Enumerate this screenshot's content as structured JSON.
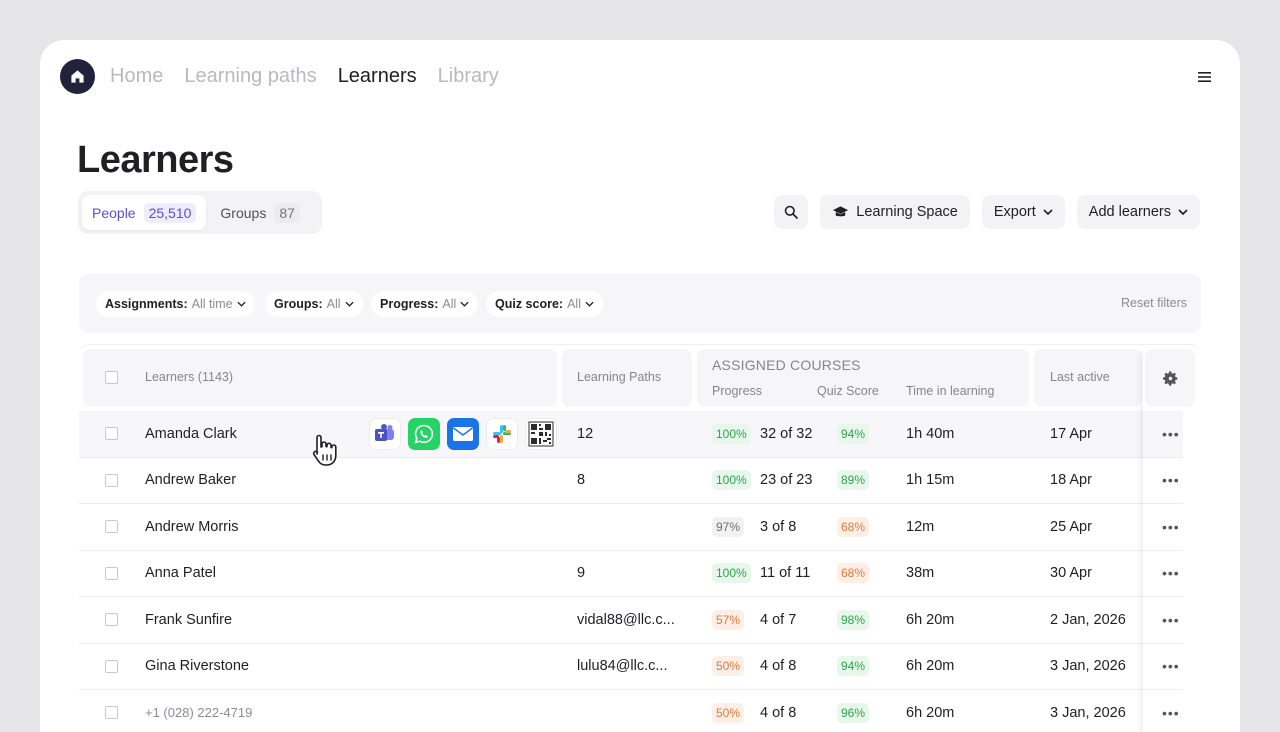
{
  "nav": {
    "items": [
      {
        "label": "Home",
        "active": false
      },
      {
        "label": "Learning paths",
        "active": false
      },
      {
        "label": "Learners",
        "active": true
      },
      {
        "label": "Library",
        "active": false
      }
    ]
  },
  "page": {
    "title": "Learners"
  },
  "tabs": [
    {
      "label": "People",
      "count": "25,510",
      "active": true
    },
    {
      "label": "Groups",
      "count": "87",
      "active": false
    }
  ],
  "toolbar": {
    "learning_space_label": "Learning Space",
    "export_label": "Export",
    "add_learners_label": "Add learners"
  },
  "filters": {
    "items": [
      {
        "label": "Assignments:",
        "value": "All time"
      },
      {
        "label": "Groups:",
        "value": "All"
      },
      {
        "label": "Progress:",
        "value": "All"
      },
      {
        "label": "Quiz score:",
        "value": "All"
      }
    ],
    "reset_label": "Reset filters"
  },
  "table": {
    "headers": {
      "learners": "Learners (1143)",
      "learning_paths": "Learning Paths",
      "assigned_courses": "ASSIGNED COURSES",
      "progress": "Progress",
      "quiz_score": "Quiz Score",
      "time_in_learning": "Time in learning",
      "last_active": "Last active"
    },
    "rows": [
      {
        "name": "Amanda Clark",
        "paths": "12",
        "pct": "100%",
        "pct_tone": "green",
        "courses": "32 of 32",
        "quiz": "94%",
        "quiz_tone": "green",
        "time": "1h 40m",
        "last": "17 Apr"
      },
      {
        "name": "Andrew Baker",
        "paths": "8",
        "pct": "100%",
        "pct_tone": "green",
        "courses": "23 of 23",
        "quiz": "89%",
        "quiz_tone": "green",
        "time": "1h 15m",
        "last": "18 Apr"
      },
      {
        "name": "Andrew Morris",
        "paths": "",
        "pct": "97%",
        "pct_tone": "gray",
        "courses": "3 of 8",
        "quiz": "68%",
        "quiz_tone": "orange",
        "time": "12m",
        "last": "25 Apr"
      },
      {
        "name": "Anna Patel",
        "paths": "9",
        "pct": "100%",
        "pct_tone": "green",
        "courses": "11 of 11",
        "quiz": "68%",
        "quiz_tone": "orange",
        "time": "38m",
        "last": "30 Apr"
      },
      {
        "name": "Frank Sunfire",
        "paths": "vidal88@llc.c...",
        "pct": "57%",
        "pct_tone": "orange",
        "courses": "4 of 7",
        "quiz": "98%",
        "quiz_tone": "green",
        "time": "6h 20m",
        "last": "2 Jan, 2026"
      },
      {
        "name": "Gina Riverstone",
        "paths": "lulu84@llc.c...",
        "pct": "50%",
        "pct_tone": "orange",
        "courses": "4 of 8",
        "quiz": "94%",
        "quiz_tone": "green",
        "time": "6h 20m",
        "last": "3 Jan, 2026"
      },
      {
        "name": "+1 (028) 222-4719",
        "paths": "",
        "pct": "50%",
        "pct_tone": "orange",
        "courses": "4 of 8",
        "quiz": "96%",
        "quiz_tone": "green",
        "time": "6h 20m",
        "last": "3 Jan, 2026"
      }
    ],
    "row_more_label": "•••"
  },
  "share_icons": [
    "teams-icon",
    "whatsapp-icon",
    "mail-icon",
    "slack-icon",
    "qr-code-icon"
  ],
  "colors": {
    "accent": "#5b4bdb",
    "dark": "#24213d",
    "green": "#2ea34a",
    "orange": "#e5783b"
  }
}
